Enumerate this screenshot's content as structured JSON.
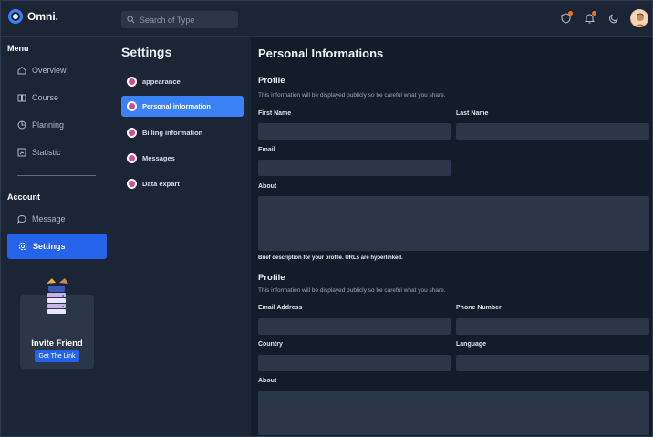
{
  "app": {
    "name": "Omni."
  },
  "search": {
    "placeholder": "Search of Type"
  },
  "topbar": {
    "icons": [
      "shield-icon",
      "bell-icon",
      "moon-icon",
      "avatar"
    ],
    "notification_color": "#f97316"
  },
  "sidebar": {
    "menu_title": "Menu",
    "menu_items": [
      {
        "label": "Overview",
        "icon": "home-icon"
      },
      {
        "label": "Course",
        "icon": "book-icon"
      },
      {
        "label": "Planning",
        "icon": "pie-chart-icon"
      },
      {
        "label": "Statistic",
        "icon": "chart-icon"
      }
    ],
    "account_title": "Account",
    "account_items": [
      {
        "label": "Message",
        "icon": "chat-icon"
      },
      {
        "label": "Settings",
        "icon": "gear-icon",
        "active": true
      }
    ],
    "invite": {
      "title": "Invite Friend",
      "button": "Get The Link"
    }
  },
  "settings": {
    "title": "Settings",
    "items": [
      {
        "label": "appearance"
      },
      {
        "label": "Personal information",
        "active": true
      },
      {
        "label": "Billing information"
      },
      {
        "label": "Messages"
      },
      {
        "label": "Data expart"
      }
    ]
  },
  "form": {
    "title": "Personal Informations",
    "section1": {
      "heading": "Profile",
      "description": "This information will be displayed publicly so be careful what you share.",
      "first_name_label": "First Name",
      "first_name_value": "",
      "last_name_label": "Last Name",
      "last_name_value": "",
      "email_label": "Email",
      "email_value": "",
      "about_label": "About",
      "about_value": "",
      "about_hint": "Brief description for your profile. URLs are hyperlinked."
    },
    "section2": {
      "heading": "Profile",
      "description": "This information will be displayed publicly so be careful what you share.",
      "email_address_label": "Email Address",
      "email_address_value": "",
      "phone_label": "Phone Number",
      "phone_value": "",
      "country_label": "Country",
      "country_value": "",
      "language_label": "Language",
      "language_value": "",
      "about_label": "About",
      "about_value": ""
    }
  },
  "colors": {
    "accent": "#2563eb",
    "active_item": "#3b82f6",
    "background": "#1b2536",
    "panel": "#141c2a",
    "input": "#2b3748"
  }
}
